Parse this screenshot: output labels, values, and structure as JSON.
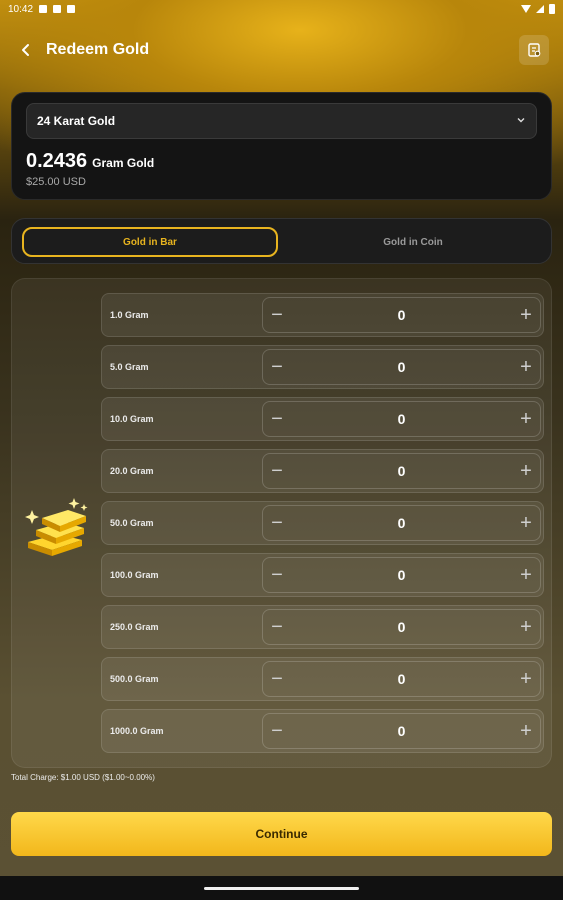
{
  "status_bar": {
    "time": "10:42"
  },
  "header": {
    "title": "Redeem Gold"
  },
  "summary": {
    "karat_selected": "24 Karat Gold",
    "amount": "0.2436",
    "amount_unit": "Gram Gold",
    "usd": "$25.00 USD"
  },
  "tabs": {
    "bar": "Gold in Bar",
    "coin": "Gold in Coin",
    "active": "bar"
  },
  "bars": [
    {
      "label": "1.0 Gram",
      "qty": "0"
    },
    {
      "label": "5.0 Gram",
      "qty": "0"
    },
    {
      "label": "10.0 Gram",
      "qty": "0"
    },
    {
      "label": "20.0 Gram",
      "qty": "0"
    },
    {
      "label": "50.0 Gram",
      "qty": "0"
    },
    {
      "label": "100.0 Gram",
      "qty": "0"
    },
    {
      "label": "250.0 Gram",
      "qty": "0"
    },
    {
      "label": "500.0 Gram",
      "qty": "0"
    },
    {
      "label": "1000.0 Gram",
      "qty": "0"
    }
  ],
  "stepper": {
    "minus": "−",
    "plus": "+"
  },
  "total_charge": "Total Charge: $1.00 USD ($1.00~0.00%)",
  "continue_label": "Continue",
  "colors": {
    "accent": "#e8b41f",
    "button": "#f5c21f",
    "card": "#141414"
  }
}
